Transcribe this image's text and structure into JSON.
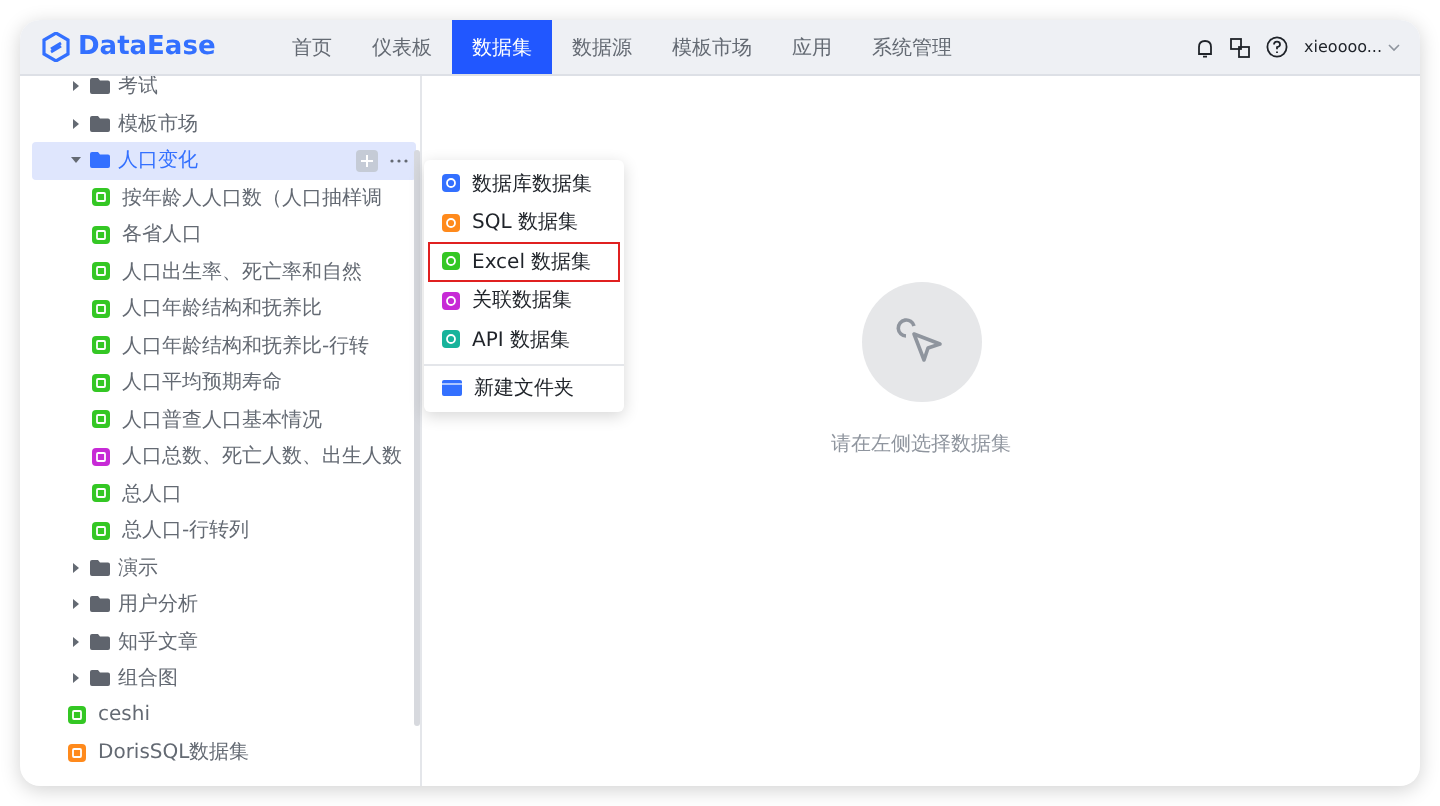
{
  "header": {
    "logo_text": "DataEase",
    "nav": [
      {
        "label": "首页",
        "selected": false
      },
      {
        "label": "仪表板",
        "selected": false
      },
      {
        "label": "数据集",
        "selected": true
      },
      {
        "label": "数据源",
        "selected": false
      },
      {
        "label": "模板市场",
        "selected": false
      },
      {
        "label": "应用",
        "selected": false
      },
      {
        "label": "系统管理",
        "selected": false
      }
    ],
    "user": "xieoooo..."
  },
  "tree": [
    {
      "label": "考试",
      "kind": "folder",
      "expanded": false,
      "selected": false
    },
    {
      "label": "模板市场",
      "kind": "folder",
      "expanded": false,
      "selected": false
    },
    {
      "label": "人口变化",
      "kind": "folder",
      "expanded": true,
      "selected": true,
      "children": [
        {
          "label": "按年龄人人口数（人口抽样调",
          "kind": "excel",
          "selected": false
        },
        {
          "label": "各省人口",
          "kind": "excel",
          "selected": false
        },
        {
          "label": "人口出生率、死亡率和自然",
          "kind": "excel",
          "selected": false
        },
        {
          "label": "人口年龄结构和抚养比",
          "kind": "excel",
          "selected": false
        },
        {
          "label": "人口年龄结构和抚养比-行转",
          "kind": "excel",
          "selected": false
        },
        {
          "label": "人口平均预期寿命",
          "kind": "excel",
          "selected": false
        },
        {
          "label": "人口普查人口基本情况",
          "kind": "excel",
          "selected": false
        },
        {
          "label": "人口总数、死亡人数、出生人数",
          "kind": "union",
          "selected": false
        },
        {
          "label": "总人口",
          "kind": "excel",
          "selected": false
        },
        {
          "label": "总人口-行转列",
          "kind": "excel",
          "selected": false
        }
      ]
    },
    {
      "label": "演示",
      "kind": "folder",
      "expanded": false,
      "selected": false
    },
    {
      "label": "用户分析",
      "kind": "folder",
      "expanded": false,
      "selected": false
    },
    {
      "label": "知乎文章",
      "kind": "folder",
      "expanded": false,
      "selected": false
    },
    {
      "label": "组合图",
      "kind": "folder",
      "expanded": false,
      "selected": false
    },
    {
      "label": "ceshi",
      "kind": "excel",
      "selected": false
    },
    {
      "label": "DorisSQL数据集",
      "kind": "sql",
      "selected": false
    }
  ],
  "menu": [
    {
      "label": "数据库数据集",
      "kind": "database",
      "selected": false
    },
    {
      "label": "SQL 数据集",
      "kind": "sql",
      "selected": false
    },
    {
      "label": "Excel 数据集",
      "kind": "excel",
      "selected": true
    },
    {
      "label": "关联数据集",
      "kind": "union",
      "selected": false
    },
    {
      "label": "API 数据集",
      "kind": "api",
      "selected": false
    },
    {
      "label": "新建文件夹",
      "kind": "folder",
      "selected": false
    }
  ],
  "empty_state": {
    "message": "请在左侧选择数据集"
  }
}
